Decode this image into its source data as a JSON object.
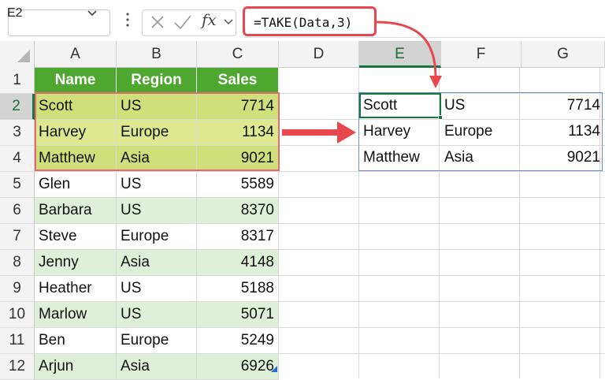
{
  "name_box": {
    "value": "E2"
  },
  "formula_bar": {
    "fx_label": "fx",
    "formula": "=TAKE(Data,3)",
    "cancel_icon": "close-icon",
    "enter_icon": "checkmark-icon"
  },
  "columns": [
    "A",
    "B",
    "C",
    "D",
    "E",
    "F",
    "G"
  ],
  "selected_column": "E",
  "rows": [
    "1",
    "2",
    "3",
    "4",
    "5",
    "6",
    "7",
    "8",
    "9",
    "10",
    "11",
    "12"
  ],
  "selected_row": "2",
  "table": {
    "headers": [
      "Name",
      "Region",
      "Sales"
    ],
    "rows": [
      [
        "Scott",
        "US",
        "7714"
      ],
      [
        "Harvey",
        "Europe",
        "1134"
      ],
      [
        "Matthew",
        "Asia",
        "9021"
      ],
      [
        "Glen",
        "US",
        "5589"
      ],
      [
        "Barbara",
        "US",
        "8370"
      ],
      [
        "Steve",
        "Europe",
        "8317"
      ],
      [
        "Jenny",
        "Asia",
        "4148"
      ],
      [
        "Heather",
        "US",
        "5188"
      ],
      [
        "Marlow",
        "US",
        "5071"
      ],
      [
        "Ben",
        "Europe",
        "5249"
      ],
      [
        "Arjun",
        "Asia",
        "6926"
      ]
    ]
  },
  "spill_result": [
    [
      "Scott",
      "US",
      "7714"
    ],
    [
      "Harvey",
      "Europe",
      "1134"
    ],
    [
      "Matthew",
      "Asia",
      "9021"
    ]
  ],
  "colors": {
    "header_green": "#4ea72e",
    "band_green": "#dff0d8",
    "highlight": "#cfe07a",
    "callout_red": "#e8474e",
    "selection_green": "#1a7340"
  }
}
